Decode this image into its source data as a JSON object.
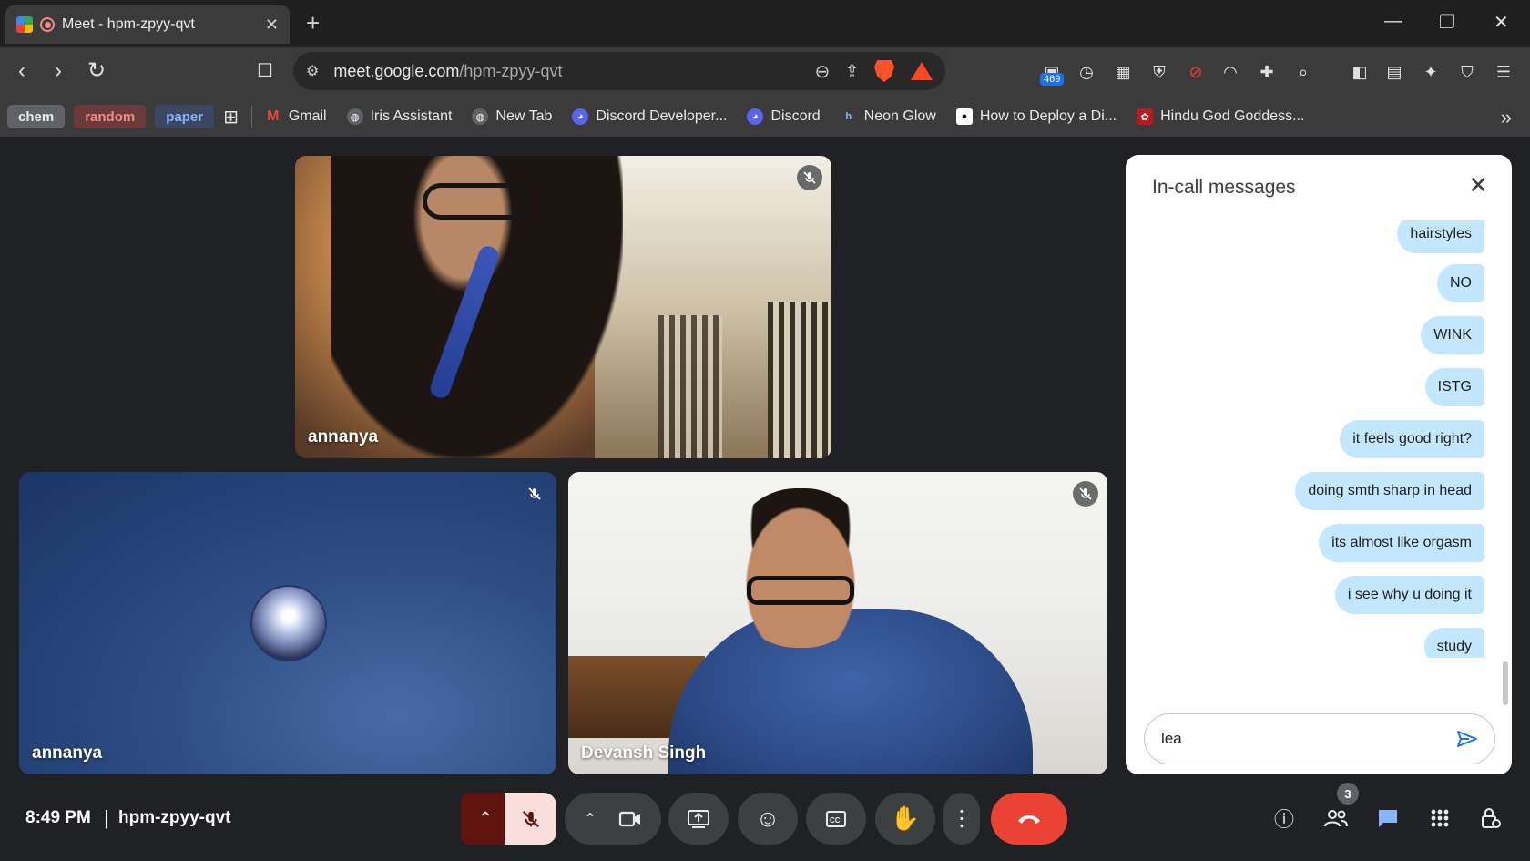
{
  "browser": {
    "tab_title": "Meet - hpm-zpyy-qvt",
    "url_host": "meet.google.com",
    "url_path": "/hpm-zpyy-qvt",
    "extension_badge": "469",
    "bookmark_groups": [
      {
        "label": "chem",
        "bg": "#5f6368",
        "fg": "#e8eaed"
      },
      {
        "label": "random",
        "bg": "#6b3a3a",
        "fg": "#f28b82"
      },
      {
        "label": "paper",
        "bg": "#3a4760",
        "fg": "#8ab4f8"
      }
    ],
    "bookmarks": [
      {
        "label": "Gmail",
        "icon": "gmail-icon",
        "color": "#ea4335"
      },
      {
        "label": "Iris Assistant",
        "icon": "globe-icon",
        "color": "#5f6368"
      },
      {
        "label": "New Tab",
        "icon": "globe-icon",
        "color": "#5f6368"
      },
      {
        "label": "Discord Developer...",
        "icon": "discord-icon",
        "color": "#5865f2"
      },
      {
        "label": "Discord",
        "icon": "discord-icon",
        "color": "#5865f2"
      },
      {
        "label": "Neon Glow",
        "icon": "hashnode-icon",
        "color": "#2962ff"
      },
      {
        "label": "How to Deploy a Di...",
        "icon": "medium-icon",
        "color": "#000000"
      },
      {
        "label": "Hindu God Goddess...",
        "icon": "image-icon",
        "color": "#b71c1c"
      }
    ]
  },
  "tiles": [
    {
      "name": "annanya"
    },
    {
      "name": "annanya"
    },
    {
      "name": "Devansh Singh"
    }
  ],
  "chat": {
    "title": "In-call messages",
    "messages": [
      "hairstyles",
      "NO",
      "WINK",
      "ISTG",
      "it feels good right?",
      "doing smth sharp in head",
      "its almost like orgasm",
      "i see why u doing it",
      "study"
    ],
    "input_value": "lea"
  },
  "meeting": {
    "time": "8:49 PM",
    "separator": "|",
    "code": "hpm-zpyy-qvt",
    "people_count": "3"
  },
  "colors": {
    "accent": "#1a73e8",
    "end_call": "#ea4335",
    "bubble": "#c2e7ff"
  }
}
